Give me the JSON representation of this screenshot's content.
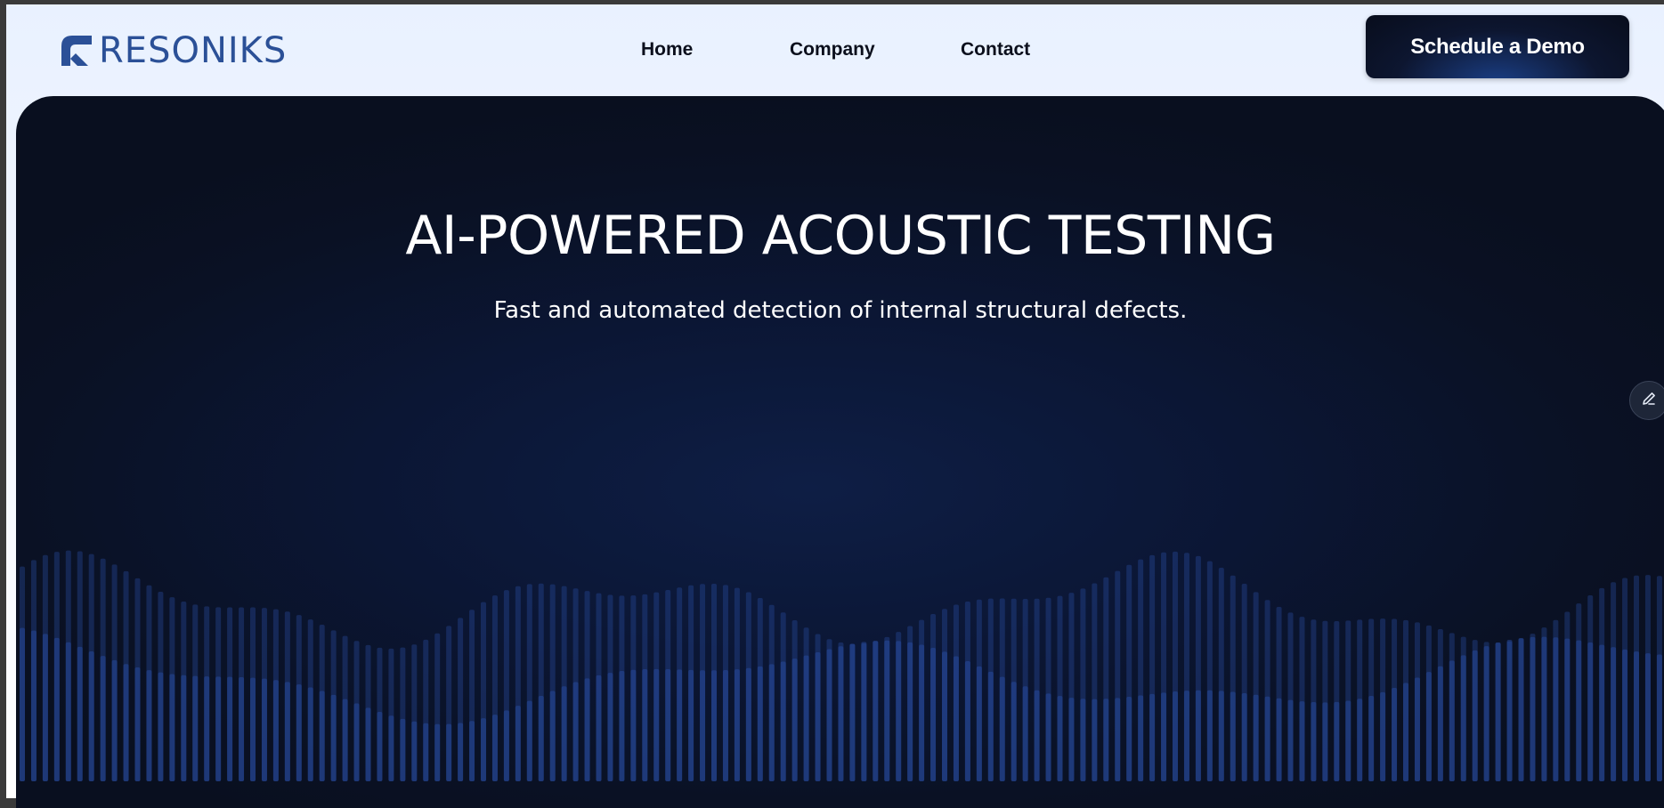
{
  "logo": {
    "text": "RESONIKS",
    "color": "#2b5097"
  },
  "nav": {
    "items": [
      {
        "label": "Home"
      },
      {
        "label": "Company"
      },
      {
        "label": "Contact"
      }
    ],
    "cta_label": "Schedule a Demo"
  },
  "hero": {
    "title": "AI-POWERED ACOUSTIC TESTING",
    "subtitle": "Fast and automated detection of internal structural defects.",
    "background": "#0a1124",
    "wave_color": "#2a4fa8"
  },
  "edit_button": {
    "icon": "pencil-icon"
  }
}
